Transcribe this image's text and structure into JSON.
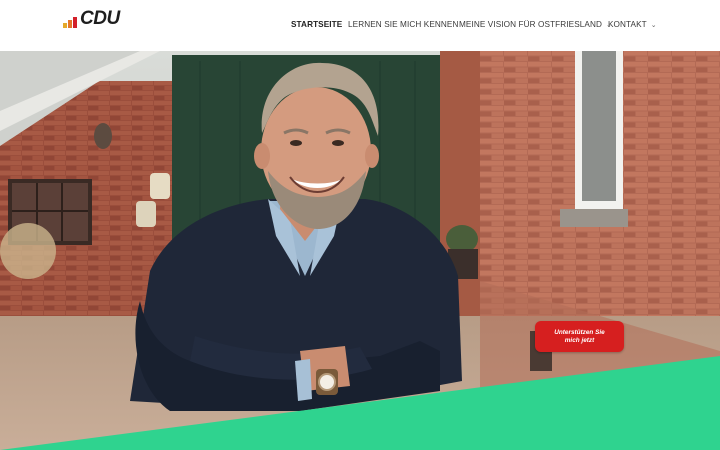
{
  "brand": {
    "logo_text": "CDU",
    "logo_icon": "cdu-bars-logo-icon"
  },
  "nav": {
    "items": [
      {
        "label": "STARTSEITE",
        "active": true,
        "has_dropdown": false
      },
      {
        "label": "LERNEN SIE MICH KENNEN",
        "active": false,
        "has_dropdown": false
      },
      {
        "label": "MEINE VISION FÜR OSTFRIESLAND",
        "active": false,
        "has_dropdown": true
      },
      {
        "label": "KONTAKT",
        "active": false,
        "has_dropdown": true
      }
    ],
    "dropdown_icon": "chevron-down-icon"
  },
  "hero": {
    "cta_label": "Unterstützen Sie mich jetzt"
  },
  "colors": {
    "brand_red": "#d61f1f",
    "accent_green": "#2fd38f",
    "text_dark": "#222222"
  }
}
